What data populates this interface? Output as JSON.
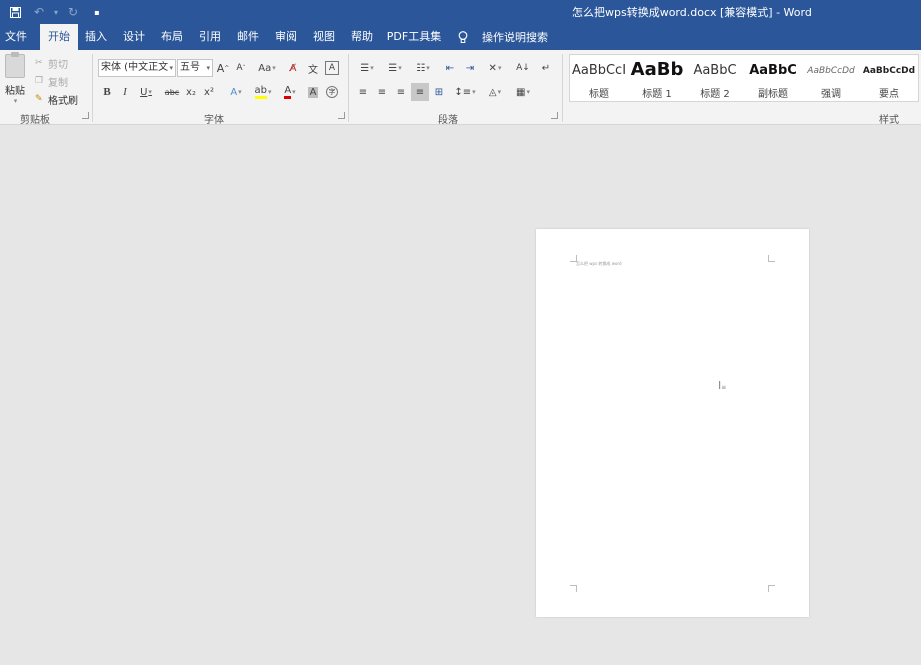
{
  "window": {
    "title": "怎么把wps转换成word.docx [兼容模式]  -  Word"
  },
  "qat": {
    "save_icon": "save-icon",
    "undo_icon": "undo-icon",
    "redo_icon": "redo-icon"
  },
  "tabs": [
    {
      "label": "文件"
    },
    {
      "label": "开始"
    },
    {
      "label": "插入"
    },
    {
      "label": "设计"
    },
    {
      "label": "布局"
    },
    {
      "label": "引用"
    },
    {
      "label": "邮件"
    },
    {
      "label": "审阅"
    },
    {
      "label": "视图"
    },
    {
      "label": "帮助"
    },
    {
      "label": "PDF工具集"
    }
  ],
  "tell_me": {
    "label": "操作说明搜索"
  },
  "clipboard": {
    "group_label": "剪贴板",
    "paste_label": "粘贴",
    "cut_label": "剪切",
    "copy_label": "复制",
    "format_painter_label": "格式刷"
  },
  "font": {
    "group_label": "字体",
    "family_value": "宋体 (中文正文",
    "size_value": "五号",
    "grow": "A",
    "shrink": "A",
    "case": "Aa",
    "bold": "B",
    "italic": "I",
    "underline": "U",
    "strike": "abc",
    "subscript": "x₂",
    "superscript": "x²",
    "font_color": "A",
    "char_shading": "A"
  },
  "paragraph": {
    "group_label": "段落"
  },
  "styles": {
    "group_label": "样式",
    "items": [
      {
        "sample": "AaBbCcI",
        "name": "标题"
      },
      {
        "sample": "AaBb",
        "name": "标题 1"
      },
      {
        "sample": "AaBbC",
        "name": "标题 2"
      },
      {
        "sample": "AaBbC",
        "name": "副标题"
      },
      {
        "sample": "AaBbCcDd",
        "name": "强调"
      },
      {
        "sample": "AaBbCcDd",
        "name": "要点"
      }
    ]
  },
  "document": {
    "text": "怎么把 wps 转换成 word"
  },
  "colors": {
    "brand": "#2b579a",
    "ribbon": "#f3f3f3",
    "canvas": "#e6e6e6",
    "highlight": "#ffff00",
    "font_color": "#e00000"
  }
}
